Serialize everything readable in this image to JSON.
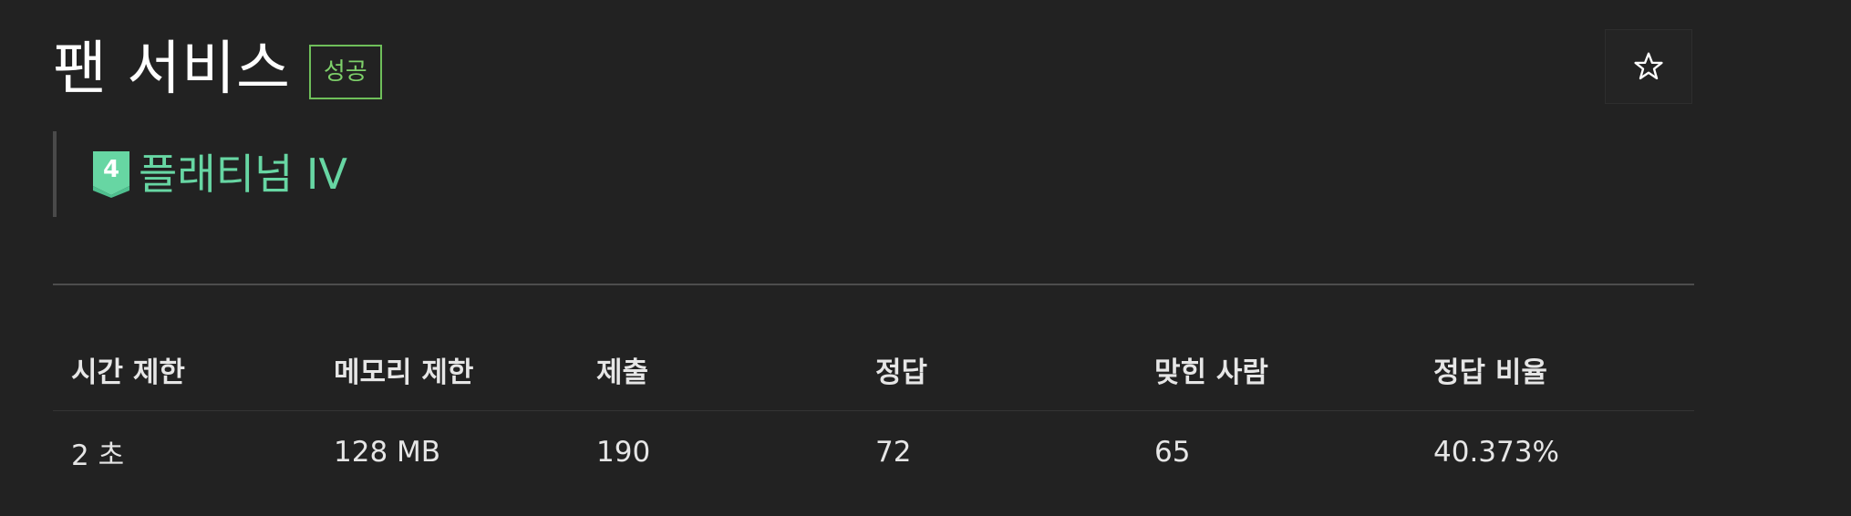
{
  "problem": {
    "title": "팬 서비스",
    "result_badge": "성공",
    "tier_number": "4",
    "tier_label": "플래티넘 IV"
  },
  "actions": {
    "star_icon": "star-outline-icon"
  },
  "stats": {
    "headers": [
      "시간 제한",
      "메모리 제한",
      "제출",
      "정답",
      "맞힌 사람",
      "정답 비율"
    ],
    "values": [
      "2 초",
      "128 MB",
      "190",
      "72",
      "65",
      "40.373%"
    ]
  },
  "colors": {
    "background": "#222222",
    "tier": "#67d6a3",
    "success": "#7ed06a"
  }
}
